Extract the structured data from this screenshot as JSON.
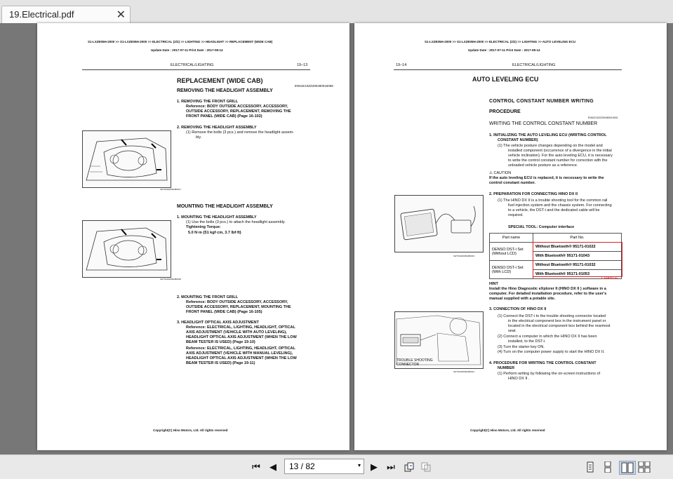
{
  "tab": {
    "title": "19.Electrical.pdf",
    "close": "✕"
  },
  "page1": {
    "breadcrumb": "S1-LXZE05H-2000 >> S1-LXZE05H-2000 >> ELECTRICAL (2/2) >> LIGHTING >> HEADLIGHT >> REPLACEMENT (WIDE CAB)",
    "update": "Update Date : 2017-07-11   Print Date : 2017-08-14",
    "section": "ELECTRICAL/LIGHTING",
    "pageno": "19–13",
    "title": "REPLACEMENT (WIDE CAB)",
    "removing": "REMOVING THE HEADLIGHT ASSEMBLY",
    "code1": "EN61E10ZZ290480015068",
    "step1_head": "1.  REMOVING THE FRONT GRILL",
    "step1_ref1": "Reference: BODY OUTSIDE ACCESSORY, ACCESSORY,",
    "step1_ref2": "OUTSIDE ACCESSORY, REPLACEMENT, REMOVING THE",
    "step1_ref3": "FRONT PANEL (WIDE CAB) (Page 16-102)",
    "step2_head": "2.  REMOVING THE HEADLIGHT ASSEMBLY",
    "step2_t1": "(1)   Remove the bolts (3 pcs.) and remove the headlight assem-",
    "step2_t2": "bly.",
    "fig1_caption": "SHTS19ZZ290480017",
    "mounting": "MOUNTING THE HEADLIGHT ASSEMBLY",
    "m1_head": "1.  MOUNTING THE HEADLIGHT ASSEMBLY",
    "m1_t1": "(1)   Use the bolts (3 pcs.) to attach the headlight assembly.",
    "m1_t2": "Tightening Torque:",
    "m1_t3": "5.0  N·m {51  kgf·cm, 3.7 lbf·ft}",
    "fig2_caption": "SHTS19ZZ290480018",
    "m2_head": "2.  MOUNTING THE FRONT GRILL",
    "m2_r1": "Reference: BODY OUTSIDE ACCESSORY, ACCESSORY,",
    "m2_r2": "OUTSIDE ACCESSORY, REPLACEMENT, MOUNTING THE",
    "m2_r3": "FRONT PANEL (WIDE CAB) (Page 16-105)",
    "m3_head": "3.  HEADLIGHT OPTICAL AXIS ADJUSTMENT",
    "m3_r1": "Reference: ELECTRICAL, LIGHTING, HEADLIGHT, OPTICAL",
    "m3_r2": "AXIS ADJUSTMENT (VEHICLE WITH AUTO LEVELING),",
    "m3_r3": "HEADLIGHT OPTICAL AXIS ADJUSTMENT (WHEN THE LOW",
    "m3_r4": "BEAM TESTER IS USED) (Page 19-10)",
    "m3_r5": "Reference: ELECTRICAL, LIGHTING, HEADLIGHT, OPTICAL",
    "m3_r6": "AXIS ADJUSTMENT (VEHICLE WITH MANUAL LEVELING),",
    "m3_r7": "HEADLIGHT OPTICAL AXIS ADJUSTMENT (WHEN THE LOW",
    "m3_r8": "BEAM TESTER IS USED) (Page 19-11)",
    "footer": "Copyright(C) Hino Motors, Ltd. All rights reserved"
  },
  "page2": {
    "breadcrumb": "S1-LXZE05H-2000 >> S1-LXZE05H-2000 >> ELECTRICAL (2/2) >> LIGHTING >> AUTO LEVELING ECU",
    "update": "Update Date : 2017-07-11   Print Date : 2017-08-14",
    "pageno": "19–14",
    "section": "ELECTRICAL/LIGHTING",
    "title": "AUTO LEVELING ECU",
    "ccw1": "CONTROL  CONSTANT  NUMBER  WRITING",
    "ccw2": "PROCEDURE",
    "code": "EN61E10ZZ290480019001",
    "writing": "WRITING THE CONTROL CONSTANT NUMBER",
    "s1_h1": "1.   INITIALIZING THE AUTO LEVELING ECU (WRITING CONTROL",
    "s1_h2": "CONSTANT NUMBER)",
    "s1_t1": "(1)   The vehicle posture changes depending on the model and",
    "s1_t2": "installed component (occurrence of a divergence in the initial",
    "s1_t3": "vehicle inclination). For the auto leveling ECU, it is necessary",
    "s1_t4": "to write the control constant number for correction with the",
    "s1_t5": "unloaded vehicle posture as a reference.",
    "caution_label": "CAUTION",
    "caution1": "If the auto leveling ECU is replaced, it is necessary to write the",
    "caution2": "control constant number.",
    "s2_head": "2.   PREPARATION FOR CONNECTING HINO DX II",
    "s2_t1": "(1)   The HINO DX II is a trouble shooting tool for the common rail",
    "s2_t2": "fuel injection system and the chassis system. For connecting",
    "s2_t3": "to a vehicle, the DST-i and the dedicated cable will be",
    "s2_t4": "required.",
    "special": "SPECIAL TOOL: Computer interface",
    "table_headers": [
      "Part name",
      "Part No."
    ],
    "table_rows": [
      [
        "DENSO DST-i Set (Without LCD)",
        "Without Bluetooth® 95171-01022"
      ],
      [
        "",
        "With Bluetooth® 95171-01043"
      ],
      [
        "DENSO DST-i Set (With LCD)",
        "Without Bluetooth® 95171-01032"
      ],
      [
        "",
        "With Bluetooth® 95171-01053"
      ]
    ],
    "change": "CHANGE",
    "fig1_caption": "SHTS19ZZ290480019",
    "hint": "HINT",
    "hint1": "Install the Hino Diagnostic eXplorer II (HINO DX II ) software in a",
    "hint2": "computer. For detailed installation procedure, refer to the user's",
    "hint3": "manual supplied with a potable site.",
    "s3_head": "3.   CONNECTION OF HINO DX II",
    "s3_t1": "(1)   Connect the DST-i to the trouble shooting connector located",
    "s3_t2": "in the electrical component box in the instrument panel or",
    "s3_t3": "located in the electrical component box behind the rearmost",
    "s3_t4": "seat.",
    "s3_t5": "(2)   Connect a computer in which the HINO DX II has been",
    "s3_t6": "installed, to the DST-i.",
    "s3_t7": "(3)   Turn the starter key ON.",
    "s3_t8": "(4)   Turn on the computer power supply to start the HINO DX II.",
    "fig2_label1": "TROUBLE SHOOTING",
    "fig2_label2": "CONNECTOR",
    "fig2_caption": "SHTS19ZZ290480014",
    "s4_h1": "4.   PROCEDURE  FOR  WRITING  THE  CONTROL  CONSTANT",
    "s4_h2": "NUMBER",
    "s4_t1": "(1)   Perform writing by following the on-screen instructions of",
    "s4_t2": "HINO DX II .",
    "footer": "Copyright(C) Hino Motors, Ltd. All rights reserved"
  },
  "toolbar": {
    "first": "⏮",
    "prev": "◀",
    "page_value": "13 / 82",
    "dropdown": "▾",
    "next": "▶",
    "last": "⏭",
    "icons": [
      "rotate-cw-icon",
      "rotate-ccw-icon",
      "single-page-icon",
      "continuous-page-icon",
      "two-page-icon",
      "two-page-continuous-icon"
    ]
  }
}
